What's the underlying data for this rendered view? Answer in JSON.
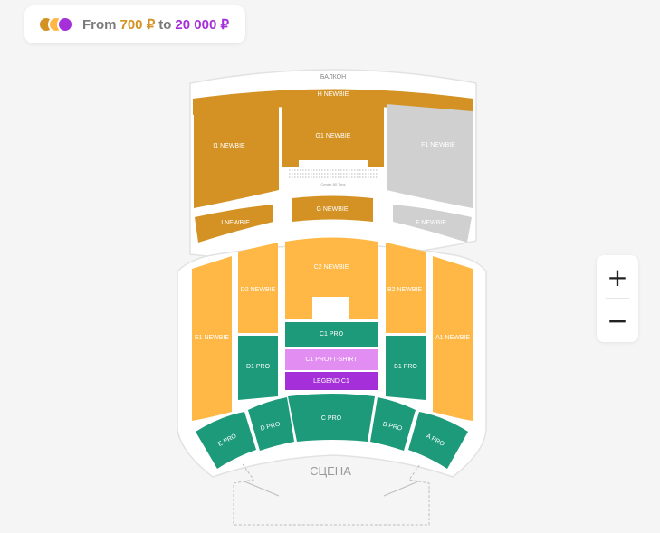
{
  "colors": {
    "newbie": "#ffb846",
    "newbie_dark": "#d39223",
    "pro": "#1d9a7a",
    "pro_tshirt": "#e28df2",
    "legend": "#a52fd8",
    "unavailable": "#d0d0d0",
    "hall_background": "#ffffff"
  },
  "price_range": {
    "legend_icon": "price-level-circles",
    "from_label": "From",
    "min_price": "700 ₽",
    "to_label": "to",
    "max_price": "20 000 ₽"
  },
  "zoom": {
    "in_label": "+",
    "out_label": "−"
  },
  "hall": {
    "balcony_label": "БАЛКОН",
    "center_rows_label": "Center 80 Tons",
    "stage_label": "СЦЕНА",
    "sections": {
      "h_newbie": "H NEWBIE",
      "i1_newbie": "I1 NEWBIE",
      "g1_newbie": "G1 NEWBIE",
      "f1_newbie": "F1 NEWBIE",
      "i_newbie": "I NEWBIE",
      "g_newbie": "G NEWBIE",
      "f_newbie": "F NEWBIE",
      "c2_newbie": "C2 NEWBIE",
      "d2_newbie": "D2 NEWBIE",
      "b2_newbie": "B2 NEWBIE",
      "e1_newbie": "E1 NEWBIE",
      "a1_newbie": "A1 NEWBIE",
      "c1_pro": "C1 PRO",
      "c1_pro_tshirt": "C1 PRO+T-SHIRT",
      "legend_c1": "LEGEND C1",
      "d1_pro": "D1 PRO",
      "b1_pro": "B1 PRO",
      "e_pro": "E PRO",
      "d_pro": "D PRO",
      "c_pro": "C PRO",
      "b_pro": "B PRO",
      "a_pro": "A PRO"
    }
  }
}
